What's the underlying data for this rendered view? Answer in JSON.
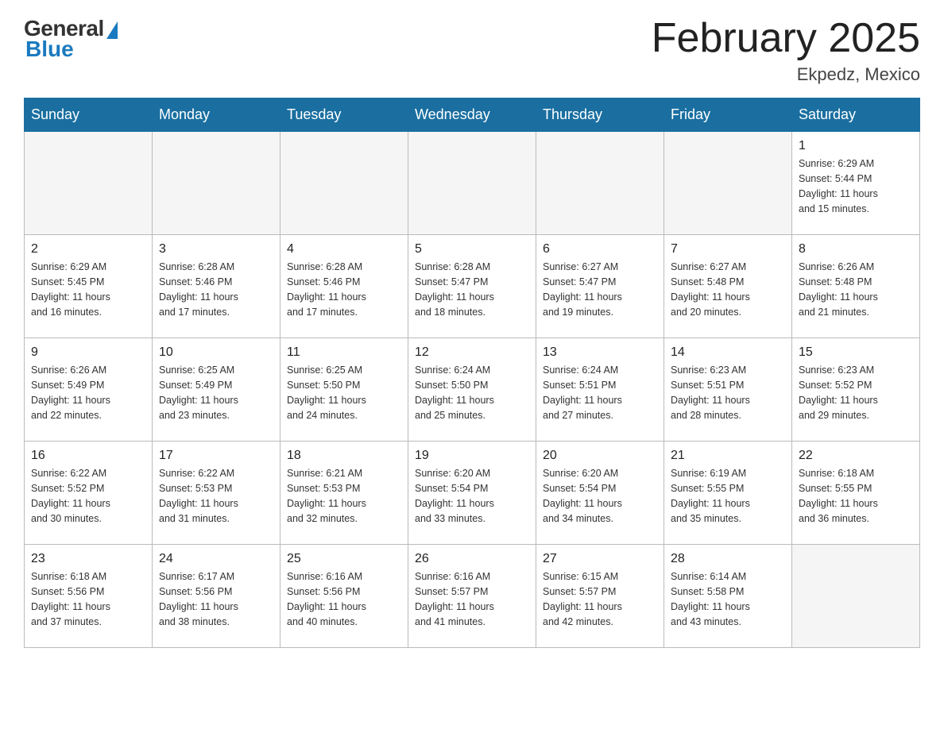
{
  "header": {
    "logo": {
      "general": "General",
      "blue": "Blue"
    },
    "title": "February 2025",
    "location": "Ekpedz, Mexico"
  },
  "days_of_week": [
    "Sunday",
    "Monday",
    "Tuesday",
    "Wednesday",
    "Thursday",
    "Friday",
    "Saturday"
  ],
  "weeks": [
    {
      "days": [
        {
          "date": "",
          "info": ""
        },
        {
          "date": "",
          "info": ""
        },
        {
          "date": "",
          "info": ""
        },
        {
          "date": "",
          "info": ""
        },
        {
          "date": "",
          "info": ""
        },
        {
          "date": "",
          "info": ""
        },
        {
          "date": "1",
          "info": "Sunrise: 6:29 AM\nSunset: 5:44 PM\nDaylight: 11 hours\nand 15 minutes."
        }
      ]
    },
    {
      "days": [
        {
          "date": "2",
          "info": "Sunrise: 6:29 AM\nSunset: 5:45 PM\nDaylight: 11 hours\nand 16 minutes."
        },
        {
          "date": "3",
          "info": "Sunrise: 6:28 AM\nSunset: 5:46 PM\nDaylight: 11 hours\nand 17 minutes."
        },
        {
          "date": "4",
          "info": "Sunrise: 6:28 AM\nSunset: 5:46 PM\nDaylight: 11 hours\nand 17 minutes."
        },
        {
          "date": "5",
          "info": "Sunrise: 6:28 AM\nSunset: 5:47 PM\nDaylight: 11 hours\nand 18 minutes."
        },
        {
          "date": "6",
          "info": "Sunrise: 6:27 AM\nSunset: 5:47 PM\nDaylight: 11 hours\nand 19 minutes."
        },
        {
          "date": "7",
          "info": "Sunrise: 6:27 AM\nSunset: 5:48 PM\nDaylight: 11 hours\nand 20 minutes."
        },
        {
          "date": "8",
          "info": "Sunrise: 6:26 AM\nSunset: 5:48 PM\nDaylight: 11 hours\nand 21 minutes."
        }
      ]
    },
    {
      "days": [
        {
          "date": "9",
          "info": "Sunrise: 6:26 AM\nSunset: 5:49 PM\nDaylight: 11 hours\nand 22 minutes."
        },
        {
          "date": "10",
          "info": "Sunrise: 6:25 AM\nSunset: 5:49 PM\nDaylight: 11 hours\nand 23 minutes."
        },
        {
          "date": "11",
          "info": "Sunrise: 6:25 AM\nSunset: 5:50 PM\nDaylight: 11 hours\nand 24 minutes."
        },
        {
          "date": "12",
          "info": "Sunrise: 6:24 AM\nSunset: 5:50 PM\nDaylight: 11 hours\nand 25 minutes."
        },
        {
          "date": "13",
          "info": "Sunrise: 6:24 AM\nSunset: 5:51 PM\nDaylight: 11 hours\nand 27 minutes."
        },
        {
          "date": "14",
          "info": "Sunrise: 6:23 AM\nSunset: 5:51 PM\nDaylight: 11 hours\nand 28 minutes."
        },
        {
          "date": "15",
          "info": "Sunrise: 6:23 AM\nSunset: 5:52 PM\nDaylight: 11 hours\nand 29 minutes."
        }
      ]
    },
    {
      "days": [
        {
          "date": "16",
          "info": "Sunrise: 6:22 AM\nSunset: 5:52 PM\nDaylight: 11 hours\nand 30 minutes."
        },
        {
          "date": "17",
          "info": "Sunrise: 6:22 AM\nSunset: 5:53 PM\nDaylight: 11 hours\nand 31 minutes."
        },
        {
          "date": "18",
          "info": "Sunrise: 6:21 AM\nSunset: 5:53 PM\nDaylight: 11 hours\nand 32 minutes."
        },
        {
          "date": "19",
          "info": "Sunrise: 6:20 AM\nSunset: 5:54 PM\nDaylight: 11 hours\nand 33 minutes."
        },
        {
          "date": "20",
          "info": "Sunrise: 6:20 AM\nSunset: 5:54 PM\nDaylight: 11 hours\nand 34 minutes."
        },
        {
          "date": "21",
          "info": "Sunrise: 6:19 AM\nSunset: 5:55 PM\nDaylight: 11 hours\nand 35 minutes."
        },
        {
          "date": "22",
          "info": "Sunrise: 6:18 AM\nSunset: 5:55 PM\nDaylight: 11 hours\nand 36 minutes."
        }
      ]
    },
    {
      "days": [
        {
          "date": "23",
          "info": "Sunrise: 6:18 AM\nSunset: 5:56 PM\nDaylight: 11 hours\nand 37 minutes."
        },
        {
          "date": "24",
          "info": "Sunrise: 6:17 AM\nSunset: 5:56 PM\nDaylight: 11 hours\nand 38 minutes."
        },
        {
          "date": "25",
          "info": "Sunrise: 6:16 AM\nSunset: 5:56 PM\nDaylight: 11 hours\nand 40 minutes."
        },
        {
          "date": "26",
          "info": "Sunrise: 6:16 AM\nSunset: 5:57 PM\nDaylight: 11 hours\nand 41 minutes."
        },
        {
          "date": "27",
          "info": "Sunrise: 6:15 AM\nSunset: 5:57 PM\nDaylight: 11 hours\nand 42 minutes."
        },
        {
          "date": "28",
          "info": "Sunrise: 6:14 AM\nSunset: 5:58 PM\nDaylight: 11 hours\nand 43 minutes."
        },
        {
          "date": "",
          "info": ""
        }
      ]
    }
  ]
}
